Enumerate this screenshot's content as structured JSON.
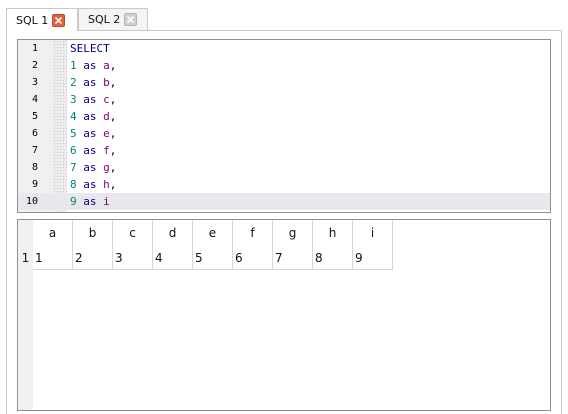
{
  "tabs": [
    {
      "label": "SQL 1",
      "active": true
    },
    {
      "label": "SQL 2",
      "active": false
    }
  ],
  "editor": {
    "lines": [
      {
        "n": "1",
        "tokens": [
          {
            "t": "SELECT",
            "c": "kw"
          }
        ]
      },
      {
        "n": "2",
        "tokens": [
          {
            "t": "1",
            "c": "num"
          },
          {
            "t": " ",
            "c": "punct"
          },
          {
            "t": "as",
            "c": "kw2"
          },
          {
            "t": " ",
            "c": "punct"
          },
          {
            "t": "a",
            "c": "ident"
          },
          {
            "t": ",",
            "c": "punct"
          }
        ]
      },
      {
        "n": "3",
        "tokens": [
          {
            "t": "2",
            "c": "num"
          },
          {
            "t": " ",
            "c": "punct"
          },
          {
            "t": "as",
            "c": "kw2"
          },
          {
            "t": " ",
            "c": "punct"
          },
          {
            "t": "b",
            "c": "ident"
          },
          {
            "t": ",",
            "c": "punct"
          }
        ]
      },
      {
        "n": "4",
        "tokens": [
          {
            "t": "3",
            "c": "num"
          },
          {
            "t": " ",
            "c": "punct"
          },
          {
            "t": "as",
            "c": "kw2"
          },
          {
            "t": " ",
            "c": "punct"
          },
          {
            "t": "c",
            "c": "ident"
          },
          {
            "t": ",",
            "c": "punct"
          }
        ]
      },
      {
        "n": "5",
        "tokens": [
          {
            "t": "4",
            "c": "num"
          },
          {
            "t": " ",
            "c": "punct"
          },
          {
            "t": "as",
            "c": "kw2"
          },
          {
            "t": " ",
            "c": "punct"
          },
          {
            "t": "d",
            "c": "ident"
          },
          {
            "t": ",",
            "c": "punct"
          }
        ]
      },
      {
        "n": "6",
        "tokens": [
          {
            "t": "5",
            "c": "num"
          },
          {
            "t": " ",
            "c": "punct"
          },
          {
            "t": "as",
            "c": "kw2"
          },
          {
            "t": " ",
            "c": "punct"
          },
          {
            "t": "e",
            "c": "ident"
          },
          {
            "t": ",",
            "c": "punct"
          }
        ]
      },
      {
        "n": "7",
        "tokens": [
          {
            "t": "6",
            "c": "num"
          },
          {
            "t": " ",
            "c": "punct"
          },
          {
            "t": "as",
            "c": "kw2"
          },
          {
            "t": " ",
            "c": "punct"
          },
          {
            "t": "f",
            "c": "ident"
          },
          {
            "t": ",",
            "c": "punct"
          }
        ]
      },
      {
        "n": "8",
        "tokens": [
          {
            "t": "7",
            "c": "num"
          },
          {
            "t": " ",
            "c": "punct"
          },
          {
            "t": "as",
            "c": "kw2"
          },
          {
            "t": " ",
            "c": "punct"
          },
          {
            "t": "g",
            "c": "ident"
          },
          {
            "t": ",",
            "c": "punct"
          }
        ]
      },
      {
        "n": "9",
        "tokens": [
          {
            "t": "8",
            "c": "num"
          },
          {
            "t": " ",
            "c": "punct"
          },
          {
            "t": "as",
            "c": "kw2"
          },
          {
            "t": " ",
            "c": "punct"
          },
          {
            "t": "h",
            "c": "ident"
          },
          {
            "t": ",",
            "c": "punct"
          }
        ]
      },
      {
        "n": "10",
        "tokens": [
          {
            "t": "9",
            "c": "num"
          },
          {
            "t": " ",
            "c": "punct"
          },
          {
            "t": "as",
            "c": "kw2"
          },
          {
            "t": " ",
            "c": "punct"
          },
          {
            "t": "i",
            "c": "ident"
          }
        ]
      }
    ],
    "current_line": 10
  },
  "results": {
    "columns": [
      "a",
      "b",
      "c",
      "d",
      "e",
      "f",
      "g",
      "h",
      "i"
    ],
    "rows": [
      {
        "row_number": "1",
        "cells": [
          "1",
          "2",
          "3",
          "4",
          "5",
          "6",
          "7",
          "8",
          "9"
        ]
      }
    ]
  },
  "colors": {
    "keyword": "#000080",
    "number": "#008080",
    "identifier": "#800080",
    "close_active": "#e5603e",
    "close_inactive": "#cfcfcf"
  },
  "icons": {
    "tab_close": "close-icon"
  }
}
